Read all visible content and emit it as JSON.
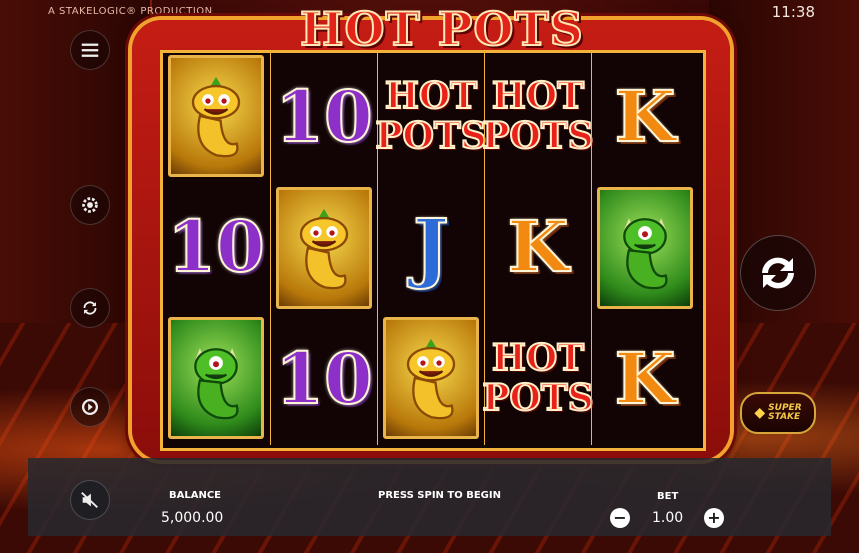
{
  "header": {
    "producer": "A STAKELOGIC® PRODUCTION",
    "time": "11:38",
    "game_title": "HOT POTS"
  },
  "side_buttons": [
    {
      "name": "menu-icon"
    },
    {
      "name": "settings-icon"
    },
    {
      "name": "autoplay-icon"
    },
    {
      "name": "turbo-icon"
    }
  ],
  "reels": [
    [
      "devil-yellow",
      "10",
      "devil-green"
    ],
    [
      "10",
      "devil-yellow",
      "10"
    ],
    [
      "HOT POTS",
      "J",
      "devil-yellow"
    ],
    [
      "HOT POTS",
      "K",
      "HOT POTS"
    ],
    [
      "K",
      "devil-green",
      "K"
    ]
  ],
  "symbols": {
    "ten": "10",
    "k": "K",
    "j": "J",
    "hotpots_line1": "HOT",
    "hotpots_line2": "POTS"
  },
  "super_stake": {
    "line1": "SUPER",
    "line2": "STAKE"
  },
  "bottom": {
    "balance_label": "BALANCE",
    "balance_value": "5,000.00",
    "message": "PRESS SPIN TO BEGIN",
    "bet_label": "BET",
    "bet_value": "1.00",
    "minus": "−",
    "plus": "+"
  },
  "colors": {
    "frame_red": "#c51d14",
    "gold": "#f0a22c",
    "purple_ten": "#8d2fc9",
    "orange_k": "#f28a12",
    "blue_j": "#2d6bd9"
  }
}
